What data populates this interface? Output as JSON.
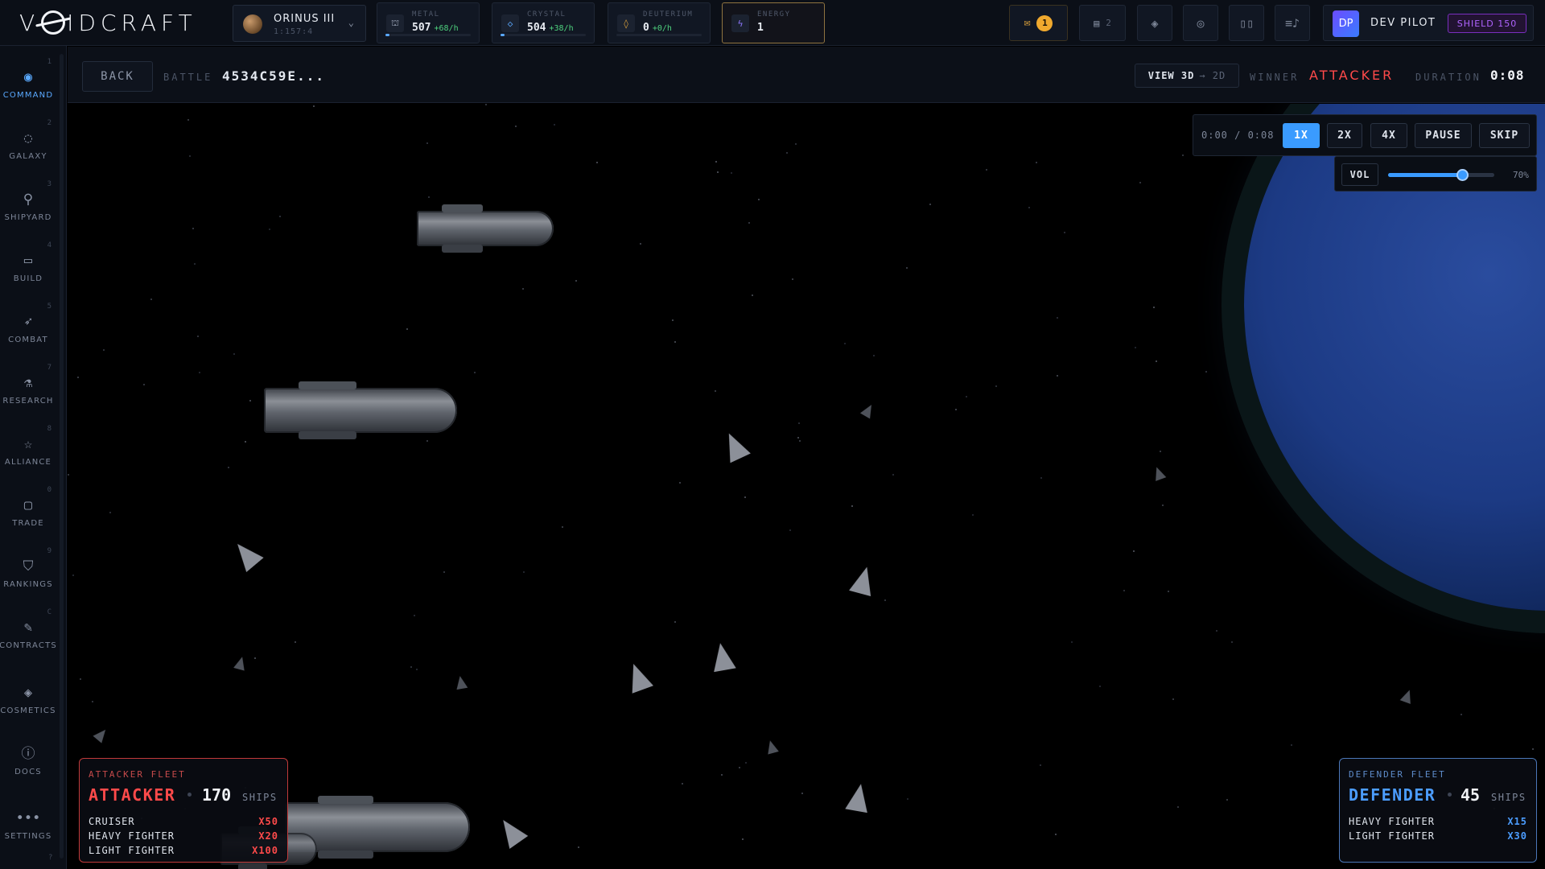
{
  "app": {
    "logo_text": "VOIDCRAFT"
  },
  "planet": {
    "name": "ORINUS III",
    "coords": "1:157:4"
  },
  "resources": [
    {
      "label": "METAL",
      "value": "507",
      "rate": "+68/h",
      "fill": 0.05,
      "icon": "metal-icon"
    },
    {
      "label": "CRYSTAL",
      "value": "504",
      "rate": "+38/h",
      "fill": 0.05,
      "icon": "crystal-icon"
    },
    {
      "label": "DEUTERIUM",
      "value": "0",
      "rate": "+0/h",
      "fill": 0,
      "icon": "deuterium-icon"
    },
    {
      "label": "ENERGY",
      "value": "1",
      "rate": "",
      "icon": "energy-icon"
    }
  ],
  "toolbar": {
    "mail_count": "1",
    "tasks_count": "2"
  },
  "user": {
    "initials": "DP",
    "name": "DEV PILOT",
    "shield": "SHIELD 150"
  },
  "sidebar": {
    "items": [
      {
        "key": "1",
        "label": "COMMAND",
        "icon": "command-icon"
      },
      {
        "key": "2",
        "label": "GALAXY",
        "icon": "galaxy-icon"
      },
      {
        "key": "3",
        "label": "SHIPYARD",
        "icon": "shipyard-icon"
      },
      {
        "key": "4",
        "label": "BUILD",
        "icon": "build-icon"
      },
      {
        "key": "5",
        "label": "COMBAT",
        "icon": "combat-icon"
      },
      {
        "key": "7",
        "label": "RESEARCH",
        "icon": "research-icon"
      },
      {
        "key": "8",
        "label": "ALLIANCE",
        "icon": "alliance-icon"
      },
      {
        "key": "0",
        "label": "TRADE",
        "icon": "trade-icon"
      },
      {
        "key": "9",
        "label": "RANKINGS",
        "icon": "rankings-icon"
      },
      {
        "key": "C",
        "label": "CONTRACTS",
        "icon": "contracts-icon"
      },
      {
        "key": "",
        "label": "COSMETICS",
        "icon": "cosmetics-icon"
      },
      {
        "key": "",
        "label": "DOCS",
        "icon": "docs-icon"
      },
      {
        "key": "?",
        "label": "SETTINGS",
        "icon": "settings-icon"
      }
    ]
  },
  "battle": {
    "back_label": "BACK",
    "battle_label": "BATTLE",
    "battle_id": "4534C59E...",
    "view_label": "VIEW 3D",
    "view_alt": "→ 2D",
    "winner_label": "WINNER",
    "winner": "ATTACKER",
    "duration_label": "DURATION",
    "duration": "0:08"
  },
  "playback": {
    "time": "0:00 / 0:08",
    "speeds": [
      "1X",
      "2X",
      "4X"
    ],
    "active_speed": "1X",
    "pause_label": "PAUSE",
    "skip_label": "SKIP",
    "vol_label": "VOL",
    "volume": 0.7,
    "volume_text": "70%"
  },
  "attacker": {
    "title": "ATTACKER FLEET",
    "name": "ATTACKER",
    "count": "170",
    "ships_label": "SHIPS",
    "units": [
      {
        "type": "CRUISER",
        "qty": "X50"
      },
      {
        "type": "HEAVY FIGHTER",
        "qty": "X20"
      },
      {
        "type": "LIGHT FIGHTER",
        "qty": "X100"
      }
    ]
  },
  "defender": {
    "title": "DEFENDER FLEET",
    "name": "DEFENDER",
    "count": "45",
    "ships_label": "SHIPS",
    "units": [
      {
        "type": "HEAVY FIGHTER",
        "qty": "X15"
      },
      {
        "type": "LIGHT FIGHTER",
        "qty": "X30"
      }
    ]
  },
  "colors": {
    "accent": "#3a9bff",
    "attacker": "#ff4a4a",
    "defender": "#4c9dff",
    "planet": "#1c3a84"
  }
}
